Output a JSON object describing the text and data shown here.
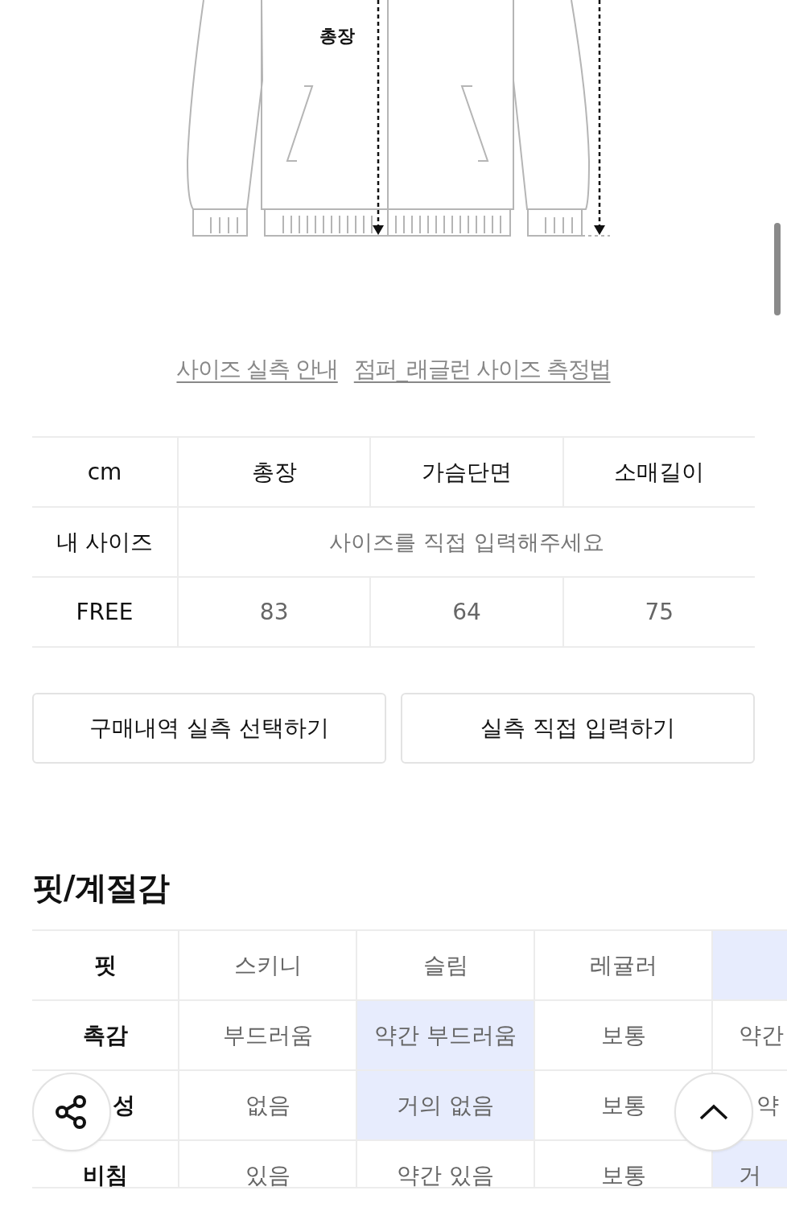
{
  "diagram": {
    "label": "총장"
  },
  "links": [
    "사이즈 실측 안내",
    "점퍼_래글런 사이즈 측정법"
  ],
  "size_table": {
    "columns": [
      "cm",
      "총장",
      "가슴단면",
      "소매길이"
    ],
    "my_size": {
      "label": "내 사이즈",
      "placeholder": "사이즈를 직접 입력해주세요"
    },
    "rows": [
      {
        "label": "FREE",
        "values": [
          "83",
          "64",
          "75"
        ]
      }
    ]
  },
  "buttons": [
    "구매내역 실측 선택하기",
    "실측 직접 입력하기"
  ],
  "fit_title": "핏/계절감",
  "fit_rows": [
    {
      "label": "핏",
      "options": [
        {
          "text": "스키니",
          "selected": false
        },
        {
          "text": "슬림",
          "selected": false
        },
        {
          "text": "레귤러",
          "selected": false
        },
        {
          "selected": true
        }
      ]
    },
    {
      "label": "촉감",
      "options": [
        {
          "text": "부드러움",
          "selected": false
        },
        {
          "text": "약간 부드러움",
          "selected": true
        },
        {
          "text": "보통",
          "selected": false
        },
        {
          "text": "약간",
          "selected": false
        }
      ]
    },
    {
      "label": "성",
      "options": [
        {
          "text": "없음",
          "selected": false
        },
        {
          "text": "거의 없음",
          "selected": true
        },
        {
          "text": "보통",
          "selected": false
        },
        {
          "text": "약",
          "selected": false
        }
      ]
    },
    {
      "label": "비침",
      "options": [
        {
          "text": "있음",
          "selected": false
        },
        {
          "text": "약간 있음",
          "selected": false
        },
        {
          "text": "보통",
          "selected": false
        },
        {
          "text": "거",
          "selected": true
        }
      ]
    }
  ]
}
